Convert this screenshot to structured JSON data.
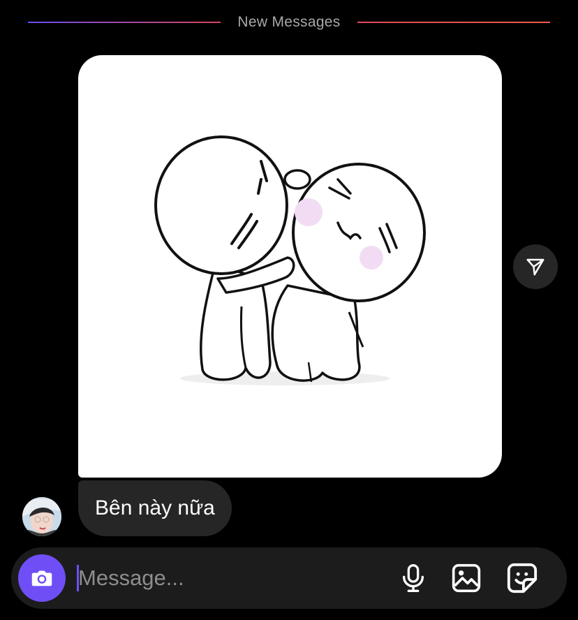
{
  "divider": {
    "label": "New Messages"
  },
  "image_message": {
    "icon": "sticker-hug-illustration"
  },
  "share": {
    "icon": "send-icon"
  },
  "text_message": {
    "text": "Bên này nữa"
  },
  "avatar": {
    "icon": "avatar-photo"
  },
  "composer": {
    "placeholder": "Message...",
    "camera_icon": "camera-icon",
    "mic_icon": "microphone-icon",
    "gallery_icon": "gallery-icon",
    "sticker_icon": "sticker-icon"
  },
  "colors": {
    "accent": "#6f4ff5",
    "bubble": "#262626",
    "background": "#000000",
    "composer": "#1c1c1c"
  }
}
